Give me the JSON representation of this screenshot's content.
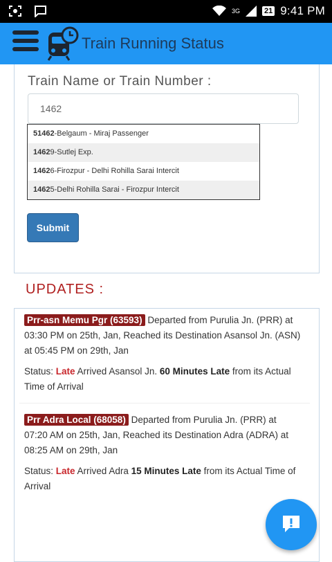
{
  "status_bar": {
    "network": "3G",
    "battery": "21",
    "time": "9:41 PM"
  },
  "app_bar": {
    "title": "Train Running Status"
  },
  "form": {
    "label": "Train Name or Train Number :",
    "input_value": "1462",
    "suggestions": [
      {
        "bold": "51462",
        "rest": "-Belgaum - Miraj Passenger"
      },
      {
        "bold": "1462",
        "rest": "9-Sutlej Exp."
      },
      {
        "bold": "1462",
        "rest": "6-Firozpur - Delhi Rohilla Sarai Intercit"
      },
      {
        "bold": "1462",
        "rest": "5-Delhi Rohilla Sarai - Firozpur Intercit"
      }
    ],
    "submit_label": "Submit"
  },
  "updates": {
    "heading": "UPDATES :",
    "items": [
      {
        "train": "Prr-asn Memu Pgr (63593)",
        "desc": "Departed from Purulia Jn. (PRR) at 03:30 PM on 25th, Jan, Reached its Destination Asansol Jn. (ASN) at 05:45 PM on 29th, Jan",
        "status_prefix": "Status: ",
        "status_word": "Late",
        "status_mid": " Arrived Asansol Jn. ",
        "late_by": "60 Minutes Late",
        "status_suffix": " from its Actual Time of Arrival"
      },
      {
        "train": "Prr Adra Local (68058)",
        "desc": "Departed from Purulia Jn. (PRR) at 07:20 AM on 25th, Jan, Reached its Destination Adra (ADRA) at 08:25 AM on 29th, Jan",
        "status_prefix": "Status: ",
        "status_word": "Late",
        "status_mid": " Arrived Adra ",
        "late_by": "15 Minutes Late",
        "status_suffix": " from its Actual Time of Arrival"
      }
    ]
  },
  "colors": {
    "app_bar": "#2196f3",
    "badge": "#8b1c1c",
    "late": "#c8262b",
    "heading": "#b02020"
  }
}
